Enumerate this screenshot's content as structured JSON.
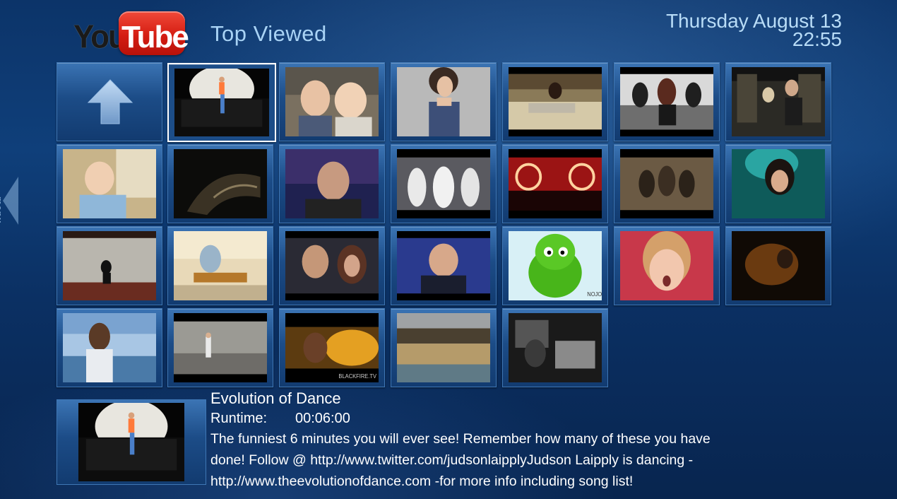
{
  "header": {
    "logo_you": "You",
    "logo_tube": "Tube",
    "section_title": "Top Viewed",
    "date": "Thursday August 13",
    "time": "22:55"
  },
  "side_menu": {
    "label": "menu"
  },
  "videos": [
    {
      "title": "Evolution of Dance",
      "selected": true
    },
    {
      "title": "",
      "caption": ""
    },
    {
      "title": ""
    },
    {
      "title": ""
    },
    {
      "title": ""
    },
    {
      "title": ""
    },
    {
      "title": "",
      "caption": ""
    },
    {
      "title": ""
    },
    {
      "title": ""
    },
    {
      "title": ""
    },
    {
      "title": ""
    },
    {
      "title": ""
    },
    {
      "title": ""
    },
    {
      "title": ""
    },
    {
      "title": ""
    },
    {
      "title": ""
    },
    {
      "title": ""
    },
    {
      "title": "",
      "caption": "NOJO"
    },
    {
      "title": ""
    },
    {
      "title": ""
    },
    {
      "title": ""
    },
    {
      "title": ""
    },
    {
      "title": "",
      "caption": "BLACKFIRE.TV"
    },
    {
      "title": ""
    },
    {
      "title": ""
    }
  ],
  "details": {
    "title": "Evolution of Dance",
    "runtime_label": "Runtime:",
    "runtime_value": "00:06:00",
    "description": "The funniest 6 minutes you will ever see! Remember how many of these you have done! Follow @ http://www.twitter.com/judsonlaipplyJudson Laipply is dancing -http://www.theevolutionofdance.com -for more info including song list!"
  },
  "colors": {
    "background": "#0c3469",
    "title_text": "#a9d3f5",
    "selection_border": "#ffffff",
    "logo_red": "#d51d12"
  }
}
